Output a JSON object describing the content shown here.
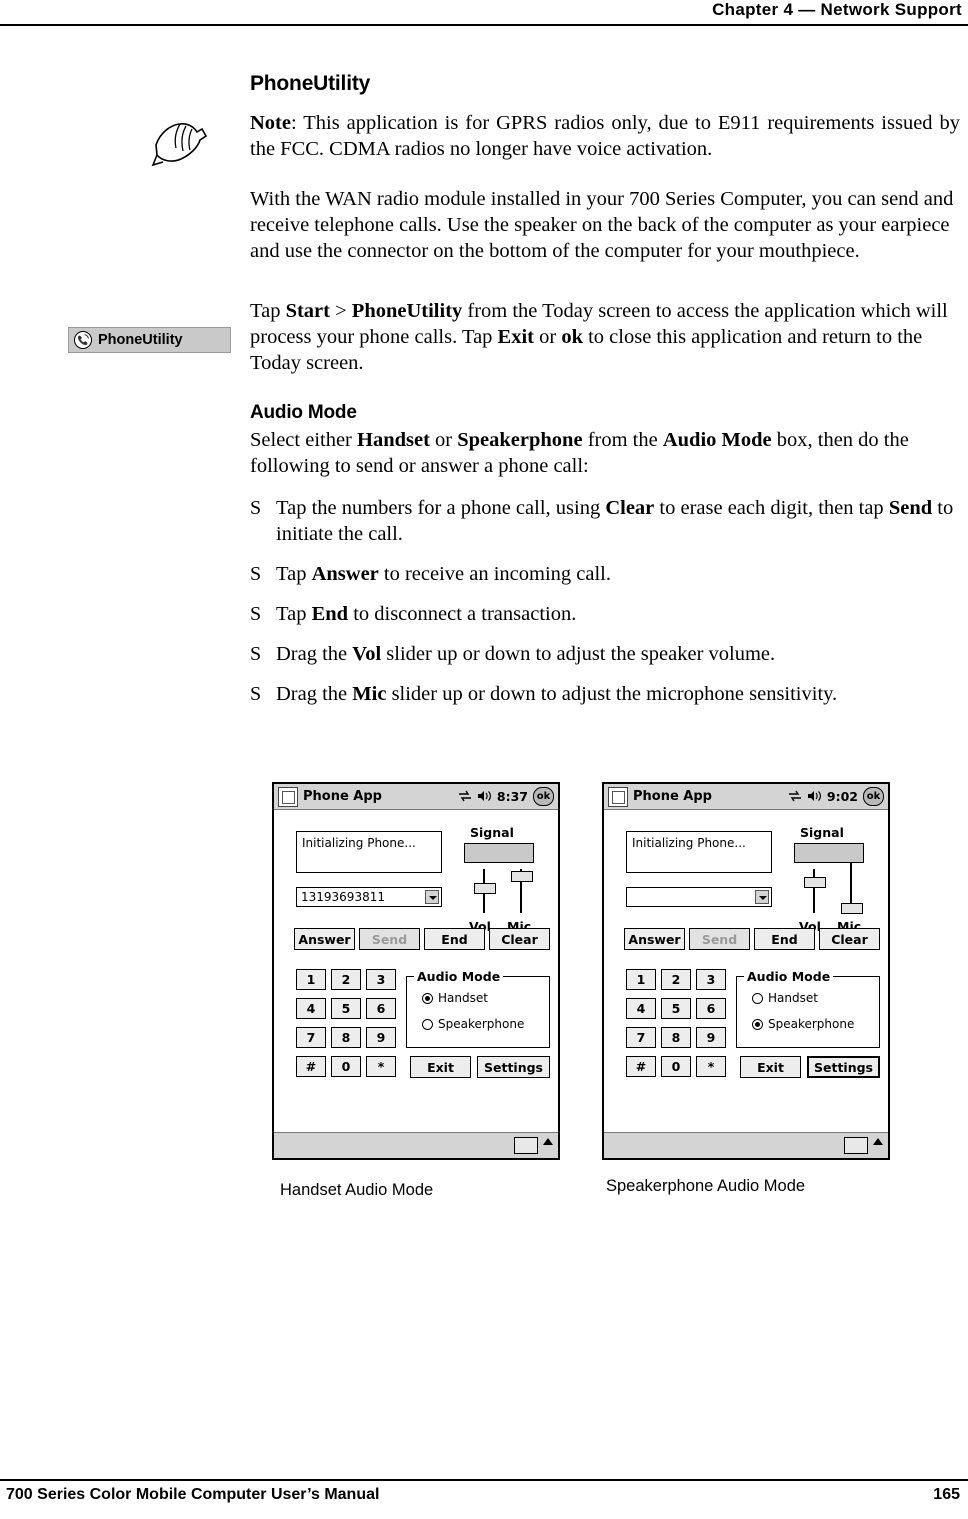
{
  "header": {
    "chapter_label": "—Chapter  4",
    "chapter_prefix": "Chapter  4",
    "title": "Network Support",
    "full": "Chapter  4  —  Network Support"
  },
  "footer": {
    "manual_title": "700 Series Color Mobile Computer User’s Manual",
    "page_number": "165"
  },
  "section": {
    "title": "PhoneUtility",
    "note_label": "Note",
    "note_text": ": This application is for GPRS radios only, due to E911 requirements issued by the FCC. CDMA radios no longer have voice activation.",
    "para1": "With the WAN radio module installed in your 700 Series Computer, you can send and receive telephone calls. Use the speaker on the back of the computer as your earpiece and use the connector on the bottom of the computer for your mouthpiece.",
    "para2_part1": "Tap ",
    "para2_b1": "Start",
    "para2_part2": " > ",
    "para2_b2": "PhoneUtility",
    "para2_part3": " from the Today screen to access the application which will process your phone calls. Tap ",
    "para2_b3": "Exit",
    "para2_part4": " or ",
    "para2_b4": "ok",
    "para2_part5": " to close this application and return to the Today screen."
  },
  "app_badge": {
    "label": "PhoneUtility",
    "icon": "phone-utility-icon"
  },
  "audio_mode": {
    "title": "Audio Mode",
    "intro_part1": "Select either ",
    "intro_b1": "Handset",
    "intro_part2": " or ",
    "intro_b2": "Speakerphone",
    "intro_part3": " from the ",
    "intro_b3": "Audio Mode",
    "intro_part4": " box, then do the following to send or answer a phone call:",
    "bullets": [
      {
        "text_1": "Tap the numbers for a phone call, using ",
        "bold_1": "Clear",
        "text_2": " to erase each digit, then tap ",
        "bold_2": "Send",
        "text_3": " to initiate the call."
      },
      {
        "text_1": "Tap ",
        "bold_1": "Answer",
        "text_2": " to receive an incoming call.",
        "bold_2": "",
        "text_3": ""
      },
      {
        "text_1": "Tap ",
        "bold_1": "End",
        "text_2": " to disconnect a transaction.",
        "bold_2": "",
        "text_3": ""
      },
      {
        "text_1": "Drag the ",
        "bold_1": "Vol",
        "text_2": " slider up or down to adjust the speaker volume.",
        "bold_2": "",
        "text_3": ""
      },
      {
        "text_1": "Drag the ",
        "bold_1": "Mic",
        "text_2": " slider up or down to adjust the microphone sensitivity.",
        "bold_2": "",
        "text_3": ""
      }
    ]
  },
  "screenshots": [
    {
      "id": "handset",
      "caption": "Handset Audio Mode",
      "titlebar": {
        "app_title": "Phone App",
        "time": "8:37",
        "ok_label": "ok",
        "sync_icon": "sync-icon",
        "volume_icon": "speaker-icon",
        "window_icon": "phone-app-icon"
      },
      "status_text": "Initializing Phone...",
      "number_field": "13193693811",
      "signal_label": "Signal",
      "vol_label": "Vol",
      "mic_label": "Mic",
      "buttons": {
        "answer": "Answer",
        "send": "Send",
        "end": "End",
        "clear": "Clear",
        "exit": "Exit",
        "settings": "Settings"
      },
      "keypad": [
        "1",
        "2",
        "3",
        "4",
        "5",
        "6",
        "7",
        "8",
        "9",
        "#",
        "0",
        "*"
      ],
      "audio_group_title": "Audio Mode",
      "radio_handset": "Handset",
      "radio_speakerphone": "Speakerphone",
      "selected_mode": "Handset",
      "taskbar_icon": "keyboard-icon"
    },
    {
      "id": "speakerphone",
      "caption": "Speakerphone Audio Mode",
      "titlebar": {
        "app_title": "Phone App",
        "time": "9:02",
        "ok_label": "ok",
        "sync_icon": "sync-icon",
        "volume_icon": "speaker-icon",
        "window_icon": "phone-app-icon"
      },
      "status_text": "Initializing Phone...",
      "number_field": "",
      "signal_label": "Signal",
      "vol_label": "Vol",
      "mic_label": "Mic",
      "buttons": {
        "answer": "Answer",
        "send": "Send",
        "end": "End",
        "clear": "Clear",
        "exit": "Exit",
        "settings": "Settings"
      },
      "keypad": [
        "1",
        "2",
        "3",
        "4",
        "5",
        "6",
        "7",
        "8",
        "9",
        "#",
        "0",
        "*"
      ],
      "audio_group_title": "Audio Mode",
      "radio_handset": "Handset",
      "radio_speakerphone": "Speakerphone",
      "selected_mode": "Speakerphone",
      "taskbar_icon": "keyboard-icon"
    }
  ]
}
